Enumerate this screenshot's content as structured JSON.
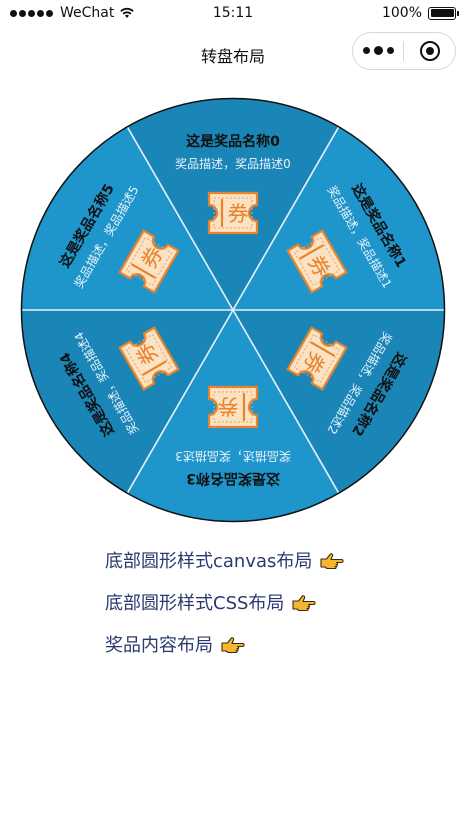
{
  "status_bar": {
    "carrier": "WeChat",
    "time": "15:11",
    "battery": "100%"
  },
  "nav": {
    "title": "转盘布局"
  },
  "wheel": {
    "colors": {
      "primary": "#1e96cc",
      "secondary": "#1a86b8",
      "divider": "#e8f2f8",
      "outline": "#111111",
      "name": "#111111",
      "desc": "#e8f2fa"
    },
    "prizes": [
      {
        "name": "这是奖品名称0",
        "desc": "奖品描述，奖品描述0",
        "coupon": "券"
      },
      {
        "name": "这是奖品名称1",
        "desc": "奖品描述，奖品描述1",
        "coupon": "券"
      },
      {
        "name": "这是奖品名称2",
        "desc": "奖品描述，奖品描述2",
        "coupon": "券"
      },
      {
        "name": "这是奖品名称3",
        "desc": "奖品描述，奖品描述3",
        "coupon": "券"
      },
      {
        "name": "这是奖品名称4",
        "desc": "奖品描述，奖品描述4",
        "coupon": "券"
      },
      {
        "name": "这是奖品名称5",
        "desc": "奖品描述，奖品描述5",
        "coupon": "券"
      }
    ]
  },
  "links": [
    {
      "label": "底部圆形样式canvas布局",
      "icon": "pointing-hand-icon"
    },
    {
      "label": "底部圆形样式CSS布局",
      "icon": "pointing-hand-icon"
    },
    {
      "label": "奖品内容布局",
      "icon": "pointing-hand-icon"
    }
  ]
}
